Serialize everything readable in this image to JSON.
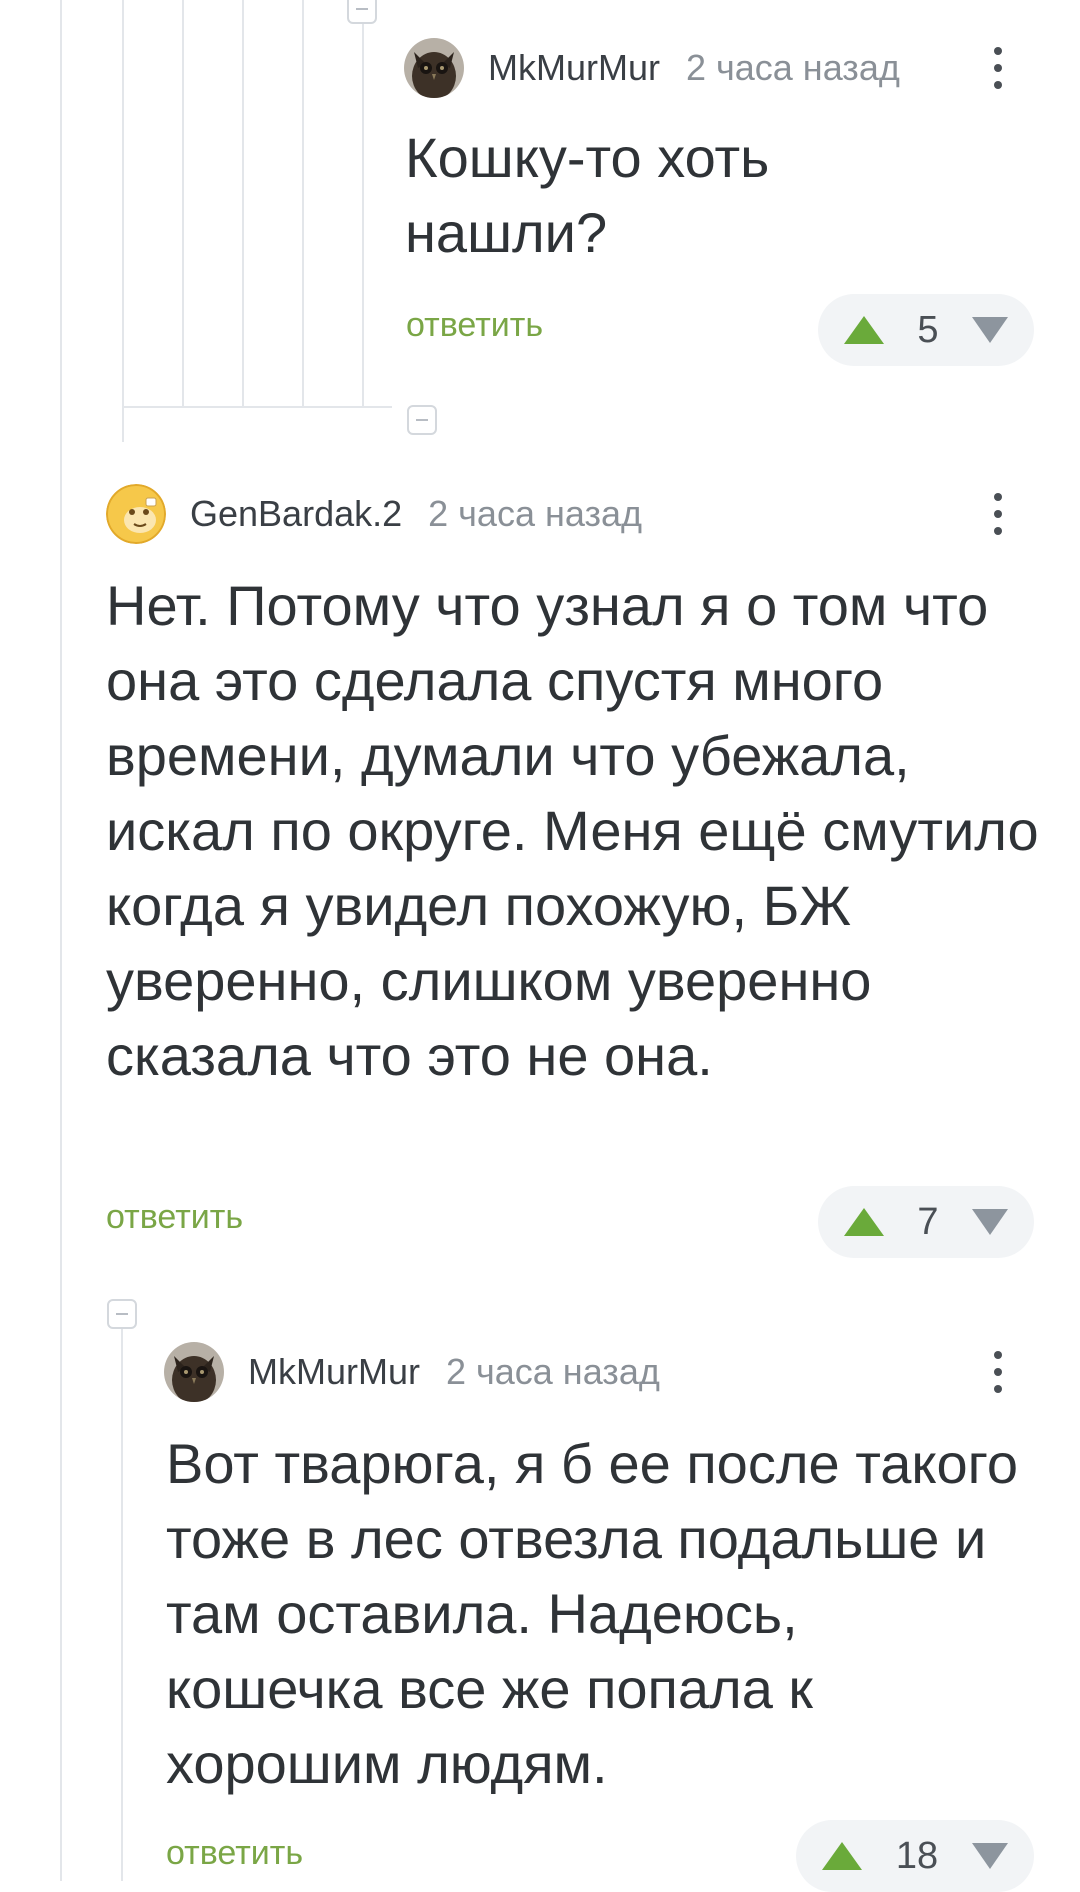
{
  "comments": [
    {
      "author": "MkMurMur",
      "time": "2 часа назад",
      "text": "Кошку-то хоть нашли?",
      "reply_label": "ответить",
      "rating": "5",
      "avatar": "owl-avatar"
    },
    {
      "author": "GenBardak.2",
      "time": "2 часа назад",
      "text": "Нет. Потому что узнал я о том что она это сделала спустя много времени, думали что убежала, искал по округе. Меня ещё смутило когда я увидел похожую, БЖ уверенно, слишком уверенно сказала что это не она.",
      "reply_label": "ответить",
      "rating": "7",
      "avatar": "yellow-face-avatar"
    },
    {
      "author": "MkMurMur",
      "time": "2 часа назад",
      "text": "Вот тварюга, я б ее после такого тоже в лес отвезла подальше и там оставила. Надеюсь, кошечка все же попала к хорошим людям.",
      "reply_label": "ответить",
      "rating": "18",
      "avatar": "owl-avatar"
    }
  ],
  "colors": {
    "accent_green": "#7aa646",
    "upvote_green": "#6aaa3a",
    "thread_line": "#e3e6ea"
  }
}
